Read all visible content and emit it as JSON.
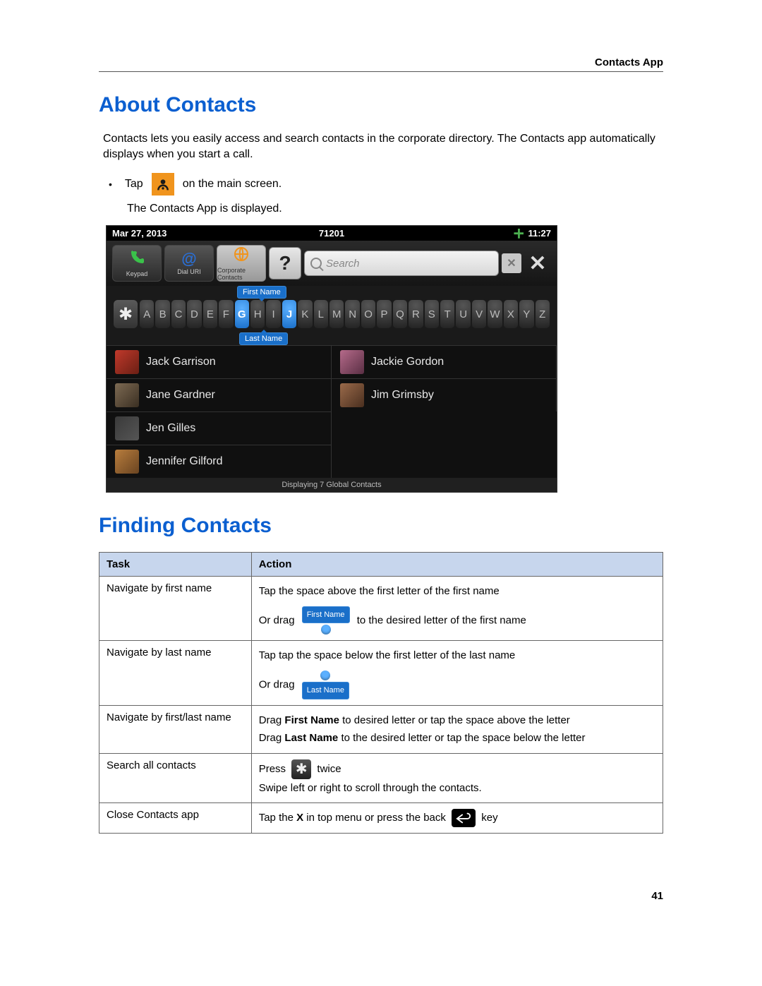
{
  "header": {
    "section": "Contacts App"
  },
  "h1a": "About Contacts",
  "intro": "Contacts lets you easily access and search contacts in the corporate directory. The Contacts app automatically displays when you start a call.",
  "bullet": {
    "pre": "Tap",
    "post": "on the main screen."
  },
  "subline": "The Contacts App is displayed.",
  "shot": {
    "date": "Mar 27, 2013",
    "ext": "71201",
    "time": "11:27",
    "tabs": {
      "keypad": "Keypad",
      "dialuri": "Dial URI",
      "corp": "Corporate Contacts"
    },
    "search_placeholder": "Search",
    "first_name_tag": "First Name",
    "last_name_tag": "Last Name",
    "letters": [
      "A",
      "B",
      "C",
      "D",
      "E",
      "F",
      "G",
      "H",
      "I",
      "J",
      "K",
      "L",
      "M",
      "N",
      "O",
      "P",
      "Q",
      "R",
      "S",
      "T",
      "U",
      "V",
      "W",
      "X",
      "Y",
      "Z"
    ],
    "active_letters": [
      "G",
      "J"
    ],
    "contacts_left": [
      "Jack Garrison",
      "Jane Gardner",
      "Jen Gilles",
      "Jennifer Gilford"
    ],
    "contacts_right": [
      "Jackie Gordon",
      "Jim Grimsby"
    ],
    "footer": "Displaying 7 Global Contacts"
  },
  "h1b": "Finding Contacts",
  "table": {
    "headers": {
      "task": "Task",
      "action": "Action"
    },
    "rows": [
      {
        "task": "Navigate by first name",
        "action_line1": "Tap the space above the first letter of the first name",
        "action_drag": "Or drag",
        "action_post": "to the desired letter of the first name",
        "widget": "firstname"
      },
      {
        "task": "Navigate by last name",
        "action_line1": "Tap tap the space below the first letter of the last name",
        "action_drag": "Or drag",
        "widget": "lastname"
      },
      {
        "task": "Navigate by first/last name",
        "l1a": "Drag ",
        "l1b": "First Name",
        "l1c": " to desired letter or tap the space above the letter",
        "l2a": "Drag ",
        "l2b": "Last Name",
        "l2c": " to the desired letter or tap the space below the letter"
      },
      {
        "task": "Search all contacts",
        "press": "Press",
        "twice": "twice",
        "swipe": "Swipe left or right to scroll through the contacts."
      },
      {
        "task": "Close Contacts app",
        "tap_a": "Tap the ",
        "tap_b": "X",
        "tap_c": " in top menu or press the back",
        "tap_d": "key"
      }
    ]
  },
  "page_number": "41",
  "chips": {
    "first": "First Name",
    "last": "Last Name"
  }
}
